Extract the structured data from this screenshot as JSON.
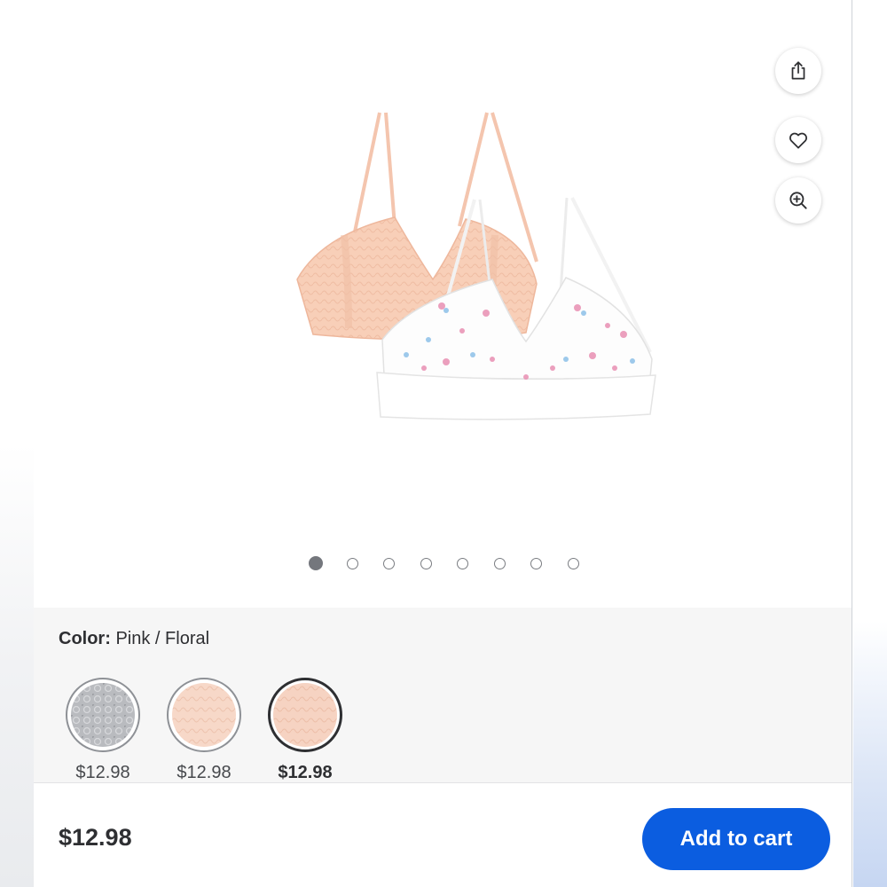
{
  "gallery": {
    "image_count": 8,
    "active_index": 0,
    "actions": {
      "share_icon": "share-icon",
      "favorite_icon": "heart-icon",
      "zoom_icon": "zoom-in-icon"
    }
  },
  "variants": {
    "color_label": "Color:",
    "color_value": "Pink / Floral",
    "swatches": [
      {
        "price": "$12.98",
        "selected": false,
        "color": "#b9bbbf"
      },
      {
        "price": "$12.98",
        "selected": false,
        "color": "#f7d8c8"
      },
      {
        "price": "$12.98",
        "selected": true,
        "color": "#f6d3c2"
      }
    ]
  },
  "footer": {
    "price": "$12.98",
    "add_to_cart_label": "Add to cart"
  },
  "colors": {
    "accent": "#0b5de0",
    "text": "#2e2f32"
  }
}
